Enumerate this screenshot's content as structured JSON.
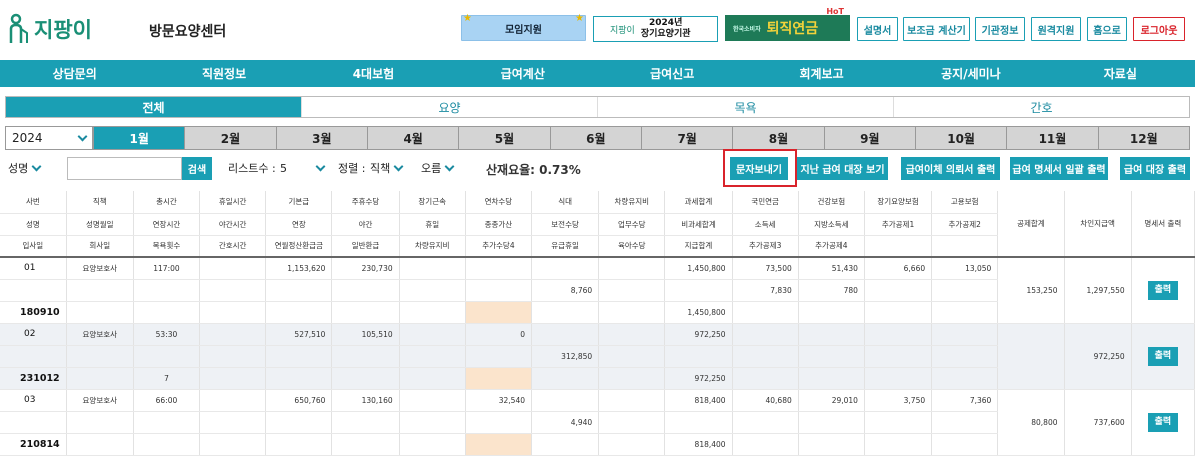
{
  "header": {
    "logo_text": "지팡이",
    "subtitle": "방문요양센터",
    "moim_label": "모임지원",
    "ad_2024": {
      "left": "지팡이",
      "line1": "2024년",
      "line2": "장기요양기관"
    },
    "ad_retire": {
      "small": "한국소비자",
      "big": "퇴직연금",
      "hot": "HoT"
    },
    "buttons": [
      "설명서",
      "보조금 계산기",
      "기관정보",
      "원격지원",
      "홈으로",
      "로그아웃"
    ]
  },
  "main_nav": [
    "상담문의",
    "직원정보",
    "4대보험",
    "급여계산",
    "급여신고",
    "회계보고",
    "공지/세미나",
    "자료실"
  ],
  "sub_tabs": [
    "전체",
    "요양",
    "목욕",
    "간호"
  ],
  "year": "2024",
  "months": [
    "1월",
    "2월",
    "3월",
    "4월",
    "5월",
    "6월",
    "7월",
    "8월",
    "9월",
    "10월",
    "11월",
    "12월"
  ],
  "filters": {
    "search_field": "성명",
    "search_button": "검색",
    "list_count_label": "리스트수 :",
    "list_count": "5",
    "sort_label": "정렬 :",
    "sort_field": "직책",
    "sort_order": "오름",
    "rate": "산재요율: 0.73%"
  },
  "toolbar": [
    "문자보내기",
    "지난 급여 대장 보기",
    "급여이체 의뢰서 출력",
    "급여 명세서 일괄 출력",
    "급여 대장 출력"
  ],
  "table": {
    "header_rows": [
      [
        "사번",
        "직책",
        "총시간",
        "휴일시간",
        "기본급",
        "주휴수당",
        "장기근속",
        "연차수당",
        "식대",
        "차량유지비",
        "과세합계",
        "국민연금",
        "건강보험",
        "장기요양보험",
        "고용보험",
        "공제합계",
        "차인지급액",
        "명세서 출력"
      ],
      [
        "성명",
        "성명월일",
        "연장시간",
        "야간시간",
        "연장",
        "야간",
        "휴일",
        "종종가산",
        "보전수당",
        "업무수당",
        "비과세합계",
        "소득세",
        "지방소득세",
        "추가공제1",
        "추가공제2"
      ],
      [
        "입사일",
        "회사일",
        "목욕횟수",
        "간호시간",
        "연월정산환급금",
        "일반환급",
        "차량유지비",
        "추가수당4",
        "유급휴일",
        "육아수당",
        "지급합계",
        "추가공제3",
        "추가공제4"
      ]
    ],
    "rows": [
      {
        "id": "01",
        "position": "요양보호사",
        "total_hours": "117:00",
        "join_date": "180910",
        "r1": [
          "1,153,620",
          "230,730",
          "",
          "",
          "",
          "",
          "1,450,800",
          "73,500",
          "51,430",
          "6,660",
          "13,050"
        ],
        "r2_meal": "8,760",
        "r2_ins": [
          "7,830",
          "780"
        ],
        "r3_total": "1,450,800",
        "deduct_total": "153,250",
        "net_pay": "1,297,550",
        "print_label": "출력"
      },
      {
        "id": "02",
        "position": "요양보호사",
        "total_hours": "53:30",
        "join_date": "231012",
        "bath_count": "7",
        "r1": [
          "527,510",
          "105,510",
          "",
          "0",
          "",
          "",
          "972,250"
        ],
        "r2_meal": "312,850",
        "r3_total": "972,250",
        "deduct_total": "",
        "net_pay": "972,250",
        "print_label": "출력"
      },
      {
        "id": "03",
        "position": "요양보호사",
        "total_hours": "66:00",
        "join_date": "210814",
        "r1": [
          "650,760",
          "130,160",
          "",
          "32,540",
          "",
          "",
          "818,400",
          "40,680",
          "29,010",
          "3,750",
          "7,360"
        ],
        "r2_meal": "4,940",
        "r3_total": "818,400",
        "deduct_total": "80,800",
        "net_pay": "737,600",
        "print_label": "출력"
      }
    ]
  },
  "colors": {
    "accent": "#1a9fb4",
    "brand": "#1a8f76",
    "highlight": "#d9232b",
    "peach": "#fbe4cc"
  }
}
